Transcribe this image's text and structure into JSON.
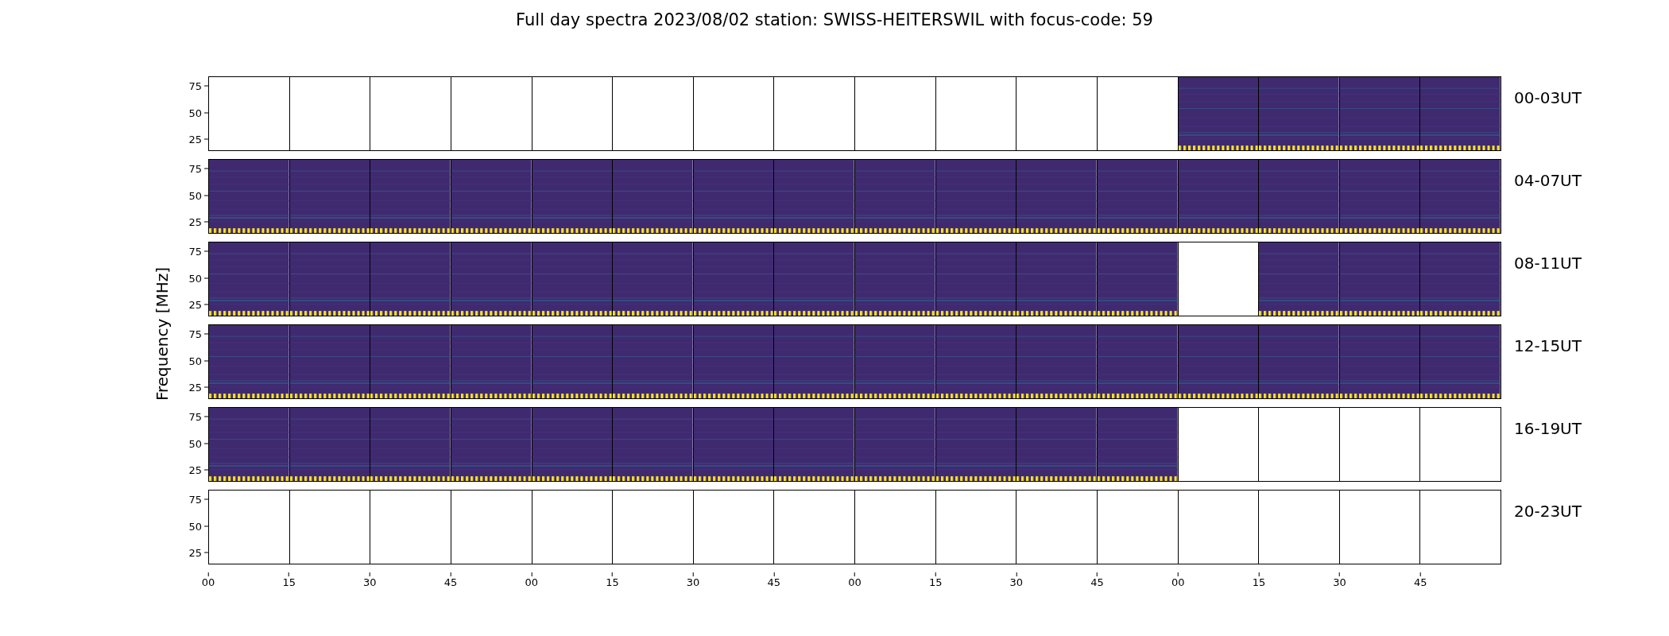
{
  "title": "Full day spectra 2023/08/02 station: SWISS-HEITERSWIL with focus-code: 59",
  "ylabel": "Frequency [MHz]",
  "rows": [
    {
      "label": "00-03UT",
      "yticks": [
        "75",
        "50",
        "25"
      ],
      "cells": [
        {
          "has_data": false
        },
        {
          "has_data": false
        },
        {
          "has_data": false
        },
        {
          "has_data": false
        },
        {
          "has_data": false
        },
        {
          "has_data": false
        },
        {
          "has_data": false
        },
        {
          "has_data": false
        },
        {
          "has_data": false
        },
        {
          "has_data": false
        },
        {
          "has_data": false
        },
        {
          "has_data": false
        },
        {
          "has_data": true
        },
        {
          "has_data": true
        },
        {
          "has_data": true
        },
        {
          "has_data": true
        }
      ]
    },
    {
      "label": "04-07UT",
      "yticks": [
        "75",
        "50",
        "25"
      ],
      "cells": [
        {
          "has_data": true
        },
        {
          "has_data": true
        },
        {
          "has_data": true
        },
        {
          "has_data": true
        },
        {
          "has_data": true
        },
        {
          "has_data": true
        },
        {
          "has_data": true
        },
        {
          "has_data": true
        },
        {
          "has_data": true
        },
        {
          "has_data": true
        },
        {
          "has_data": true
        },
        {
          "has_data": true
        },
        {
          "has_data": true
        },
        {
          "has_data": true
        },
        {
          "has_data": true
        },
        {
          "has_data": true
        }
      ]
    },
    {
      "label": "08-11UT",
      "yticks": [
        "75",
        "50",
        "25"
      ],
      "cells": [
        {
          "has_data": true
        },
        {
          "has_data": true
        },
        {
          "has_data": true
        },
        {
          "has_data": true
        },
        {
          "has_data": true
        },
        {
          "has_data": true
        },
        {
          "has_data": true
        },
        {
          "has_data": true
        },
        {
          "has_data": true
        },
        {
          "has_data": true
        },
        {
          "has_data": true
        },
        {
          "has_data": true
        },
        {
          "has_data": false
        },
        {
          "has_data": true
        },
        {
          "has_data": true
        },
        {
          "has_data": true
        }
      ]
    },
    {
      "label": "12-15UT",
      "yticks": [
        "75",
        "50",
        "25"
      ],
      "cells": [
        {
          "has_data": true
        },
        {
          "has_data": true
        },
        {
          "has_data": true
        },
        {
          "has_data": true
        },
        {
          "has_data": true
        },
        {
          "has_data": true
        },
        {
          "has_data": true
        },
        {
          "has_data": true
        },
        {
          "has_data": true
        },
        {
          "has_data": true
        },
        {
          "has_data": true
        },
        {
          "has_data": true
        },
        {
          "has_data": true
        },
        {
          "has_data": true
        },
        {
          "has_data": true
        },
        {
          "has_data": true
        }
      ]
    },
    {
      "label": "16-19UT",
      "yticks": [
        "75",
        "50",
        "25"
      ],
      "cells": [
        {
          "has_data": true
        },
        {
          "has_data": true
        },
        {
          "has_data": true
        },
        {
          "has_data": true
        },
        {
          "has_data": true
        },
        {
          "has_data": true
        },
        {
          "has_data": true
        },
        {
          "has_data": true
        },
        {
          "has_data": true
        },
        {
          "has_data": true
        },
        {
          "has_data": true
        },
        {
          "has_data": true
        },
        {
          "has_data": false
        },
        {
          "has_data": false
        },
        {
          "has_data": false
        },
        {
          "has_data": false
        }
      ]
    },
    {
      "label": "20-23UT",
      "yticks": [
        "75",
        "50",
        "25"
      ],
      "cells": [
        {
          "has_data": false
        },
        {
          "has_data": false
        },
        {
          "has_data": false
        },
        {
          "has_data": false
        },
        {
          "has_data": false
        },
        {
          "has_data": false
        },
        {
          "has_data": false
        },
        {
          "has_data": false
        },
        {
          "has_data": false
        },
        {
          "has_data": false
        },
        {
          "has_data": false
        },
        {
          "has_data": false
        },
        {
          "has_data": false
        },
        {
          "has_data": false
        },
        {
          "has_data": false
        },
        {
          "has_data": false
        }
      ]
    }
  ],
  "xticks": [
    "00",
    "15",
    "30",
    "45",
    "00",
    "15",
    "30",
    "45",
    "00",
    "15",
    "30",
    "45",
    "00",
    "15",
    "30",
    "45"
  ]
}
